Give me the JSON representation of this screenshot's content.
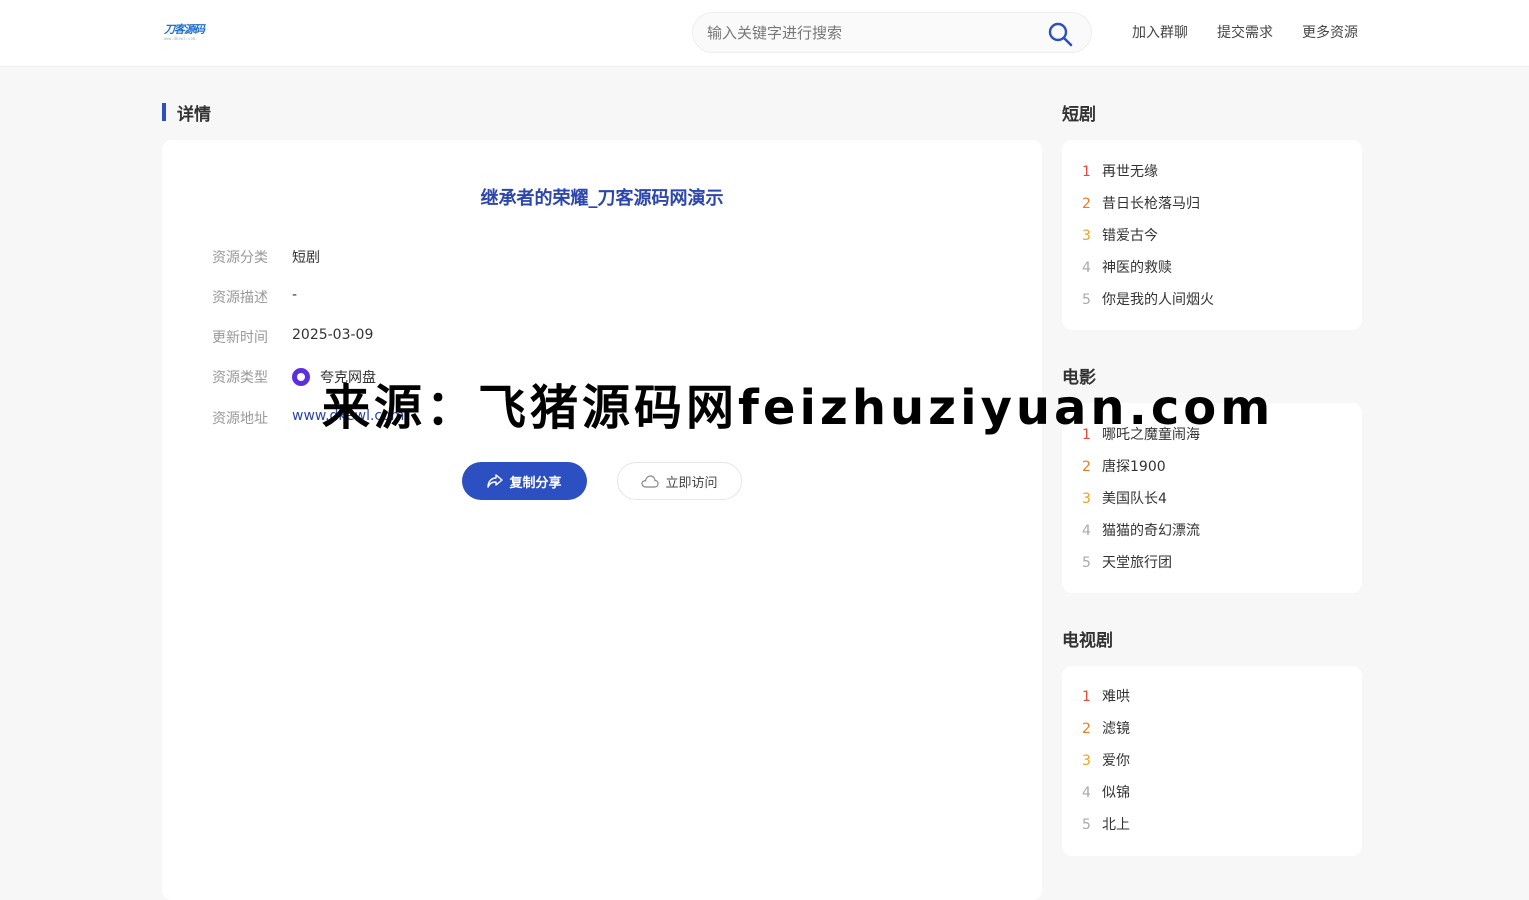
{
  "header": {
    "logo_text": "刀客源码",
    "logo_sub": "www.dkewl.com",
    "search_placeholder": "输入关键字进行搜索",
    "nav": [
      "加入群聊",
      "提交需求",
      "更多资源"
    ]
  },
  "main": {
    "section_title": "详情",
    "title": "继承者的荣耀_刀客源码网演示",
    "rows": [
      {
        "label": "资源分类",
        "value": "短剧"
      },
      {
        "label": "资源描述",
        "value": "-"
      },
      {
        "label": "更新时间",
        "value": "2025-03-09"
      },
      {
        "label": "资源类型",
        "value": "夸克网盘"
      },
      {
        "label": "资源地址",
        "value": "www.dkewl.com"
      }
    ],
    "buttons": {
      "share": "复制分享",
      "visit": "立即访问"
    }
  },
  "sidebar": [
    {
      "title": "短剧",
      "items": [
        "再世无缘",
        "昔日长枪落马归",
        "错爱古今",
        "神医的救赎",
        "你是我的人间烟火"
      ]
    },
    {
      "title": "电影",
      "items": [
        "哪吒之魔童闹海",
        "唐探1900",
        "美国队长4",
        "猫猫的奇幻漂流",
        "天堂旅行团"
      ]
    },
    {
      "title": "电视剧",
      "items": [
        "难哄",
        "滤镜",
        "爱你",
        "似锦",
        "北上"
      ]
    }
  ],
  "watermark": "来源：飞猪源码网feizhuziyuan.com",
  "colors": {
    "accent": "#2c4fc1",
    "title": "#2c46ad",
    "rank1": "#e34b3b",
    "rank2": "#f07b1f",
    "rank3": "#f0a11f"
  }
}
